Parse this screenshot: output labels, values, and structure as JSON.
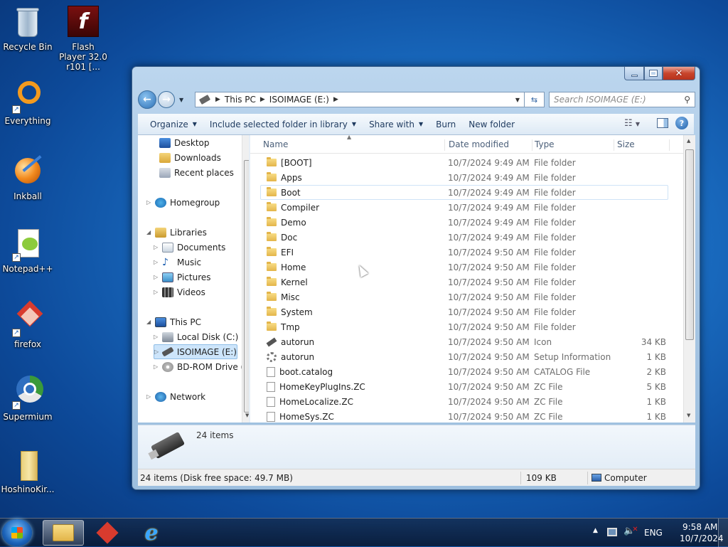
{
  "desktop": {
    "icons": [
      {
        "label": "Recycle Bin"
      },
      {
        "label": "Flash Player 32.0 r101 [..."
      },
      {
        "label": "Everything"
      },
      {
        "label": "Inkball"
      },
      {
        "label": "Notepad++"
      },
      {
        "label": "firefox"
      },
      {
        "label": "Supermium"
      },
      {
        "label": "HoshinoKir..."
      }
    ]
  },
  "window": {
    "address": {
      "segments": [
        "This PC",
        "ISOIMAGE (E:)"
      ]
    },
    "search_placeholder": "Search ISOIMAGE (E:)",
    "toolbar": {
      "organize": "Organize",
      "include": "Include selected folder in library",
      "share": "Share with",
      "burn": "Burn",
      "new_folder": "New folder"
    },
    "nav": {
      "desktop": "Desktop",
      "downloads": "Downloads",
      "recent": "Recent places",
      "homegroup": "Homegroup",
      "libraries": "Libraries",
      "documents": "Documents",
      "music": "Music",
      "pictures": "Pictures",
      "videos": "Videos",
      "thispc": "This PC",
      "localdisk": "Local Disk (C:)",
      "isoimage": "ISOIMAGE (E:)",
      "bdrom": "BD-ROM Drive (F",
      "network": "Network"
    },
    "columns": {
      "name": "Name",
      "date": "Date modified",
      "type": "Type",
      "size": "Size"
    },
    "files": [
      {
        "name": "[BOOT]",
        "date": "10/7/2024 9:49 AM",
        "type": "File folder",
        "size": ""
      },
      {
        "name": "Apps",
        "date": "10/7/2024 9:49 AM",
        "type": "File folder",
        "size": ""
      },
      {
        "name": "Boot",
        "date": "10/7/2024 9:49 AM",
        "type": "File folder",
        "size": ""
      },
      {
        "name": "Compiler",
        "date": "10/7/2024 9:49 AM",
        "type": "File folder",
        "size": ""
      },
      {
        "name": "Demo",
        "date": "10/7/2024 9:49 AM",
        "type": "File folder",
        "size": ""
      },
      {
        "name": "Doc",
        "date": "10/7/2024 9:49 AM",
        "type": "File folder",
        "size": ""
      },
      {
        "name": "EFI",
        "date": "10/7/2024 9:50 AM",
        "type": "File folder",
        "size": ""
      },
      {
        "name": "Home",
        "date": "10/7/2024 9:50 AM",
        "type": "File folder",
        "size": ""
      },
      {
        "name": "Kernel",
        "date": "10/7/2024 9:50 AM",
        "type": "File folder",
        "size": ""
      },
      {
        "name": "Misc",
        "date": "10/7/2024 9:50 AM",
        "type": "File folder",
        "size": ""
      },
      {
        "name": "System",
        "date": "10/7/2024 9:50 AM",
        "type": "File folder",
        "size": ""
      },
      {
        "name": "Tmp",
        "date": "10/7/2024 9:50 AM",
        "type": "File folder",
        "size": ""
      },
      {
        "name": "autorun",
        "date": "10/7/2024 9:50 AM",
        "type": "Icon",
        "size": "34 KB"
      },
      {
        "name": "autorun",
        "date": "10/7/2024 9:50 AM",
        "type": "Setup Information",
        "size": "1 KB"
      },
      {
        "name": "boot.catalog",
        "date": "10/7/2024 9:50 AM",
        "type": "CATALOG File",
        "size": "2 KB"
      },
      {
        "name": "HomeKeyPlugIns.ZC",
        "date": "10/7/2024 9:50 AM",
        "type": "ZC File",
        "size": "5 KB"
      },
      {
        "name": "HomeLocalize.ZC",
        "date": "10/7/2024 9:50 AM",
        "type": "ZC File",
        "size": "1 KB"
      },
      {
        "name": "HomeSys.ZC",
        "date": "10/7/2024 9:50 AM",
        "type": "ZC File",
        "size": "1 KB"
      }
    ],
    "details_count": "24 items",
    "status": {
      "items": "24 items (Disk free space: 49.7 MB)",
      "size": "109 KB",
      "location": "Computer"
    }
  },
  "taskbar": {
    "lang": "ENG",
    "time": "9:58 AM",
    "date": "10/7/2024"
  }
}
